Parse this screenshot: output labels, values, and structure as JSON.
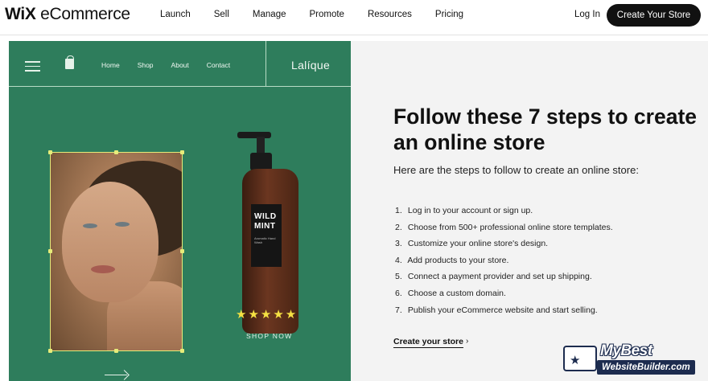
{
  "nav": {
    "logo_bold": "WiX",
    "logo_rest": "eCommerce",
    "items": [
      "Launch",
      "Sell",
      "Manage",
      "Promote",
      "Resources",
      "Pricing"
    ],
    "login": "Log In",
    "cta": "Create Your Store"
  },
  "preview": {
    "nav": [
      "Home",
      "Shop",
      "About",
      "Contact"
    ],
    "brand": "Lalíque",
    "bottle_label_line1": "WILD",
    "bottle_label_line2": "MINT",
    "bottle_label_small": "Aromatic Hand Wash",
    "stars": "★★★★★",
    "shop_now": "SHOP NOW",
    "colors": {
      "green": "#2e7d5c",
      "highlight": "#e6ec7a",
      "star": "#f5e143"
    }
  },
  "content": {
    "heading": "Follow these 7 steps to create an online store",
    "subheading": "Here are the steps to follow to create an online store:",
    "steps": [
      "Log in to your account or sign up.",
      "Choose from 500+ professional online store templates.",
      "Customize your online store's design.",
      "Add products to your store.",
      "Connect a payment provider and set up shipping.",
      "Choose a custom domain.",
      "Publish your eCommerce website and start selling."
    ],
    "link": "Create your store",
    "link_icon": "chevron-right-icon"
  },
  "watermark": {
    "top": "MyBest",
    "bottom": "WebsiteBuilder.com"
  }
}
